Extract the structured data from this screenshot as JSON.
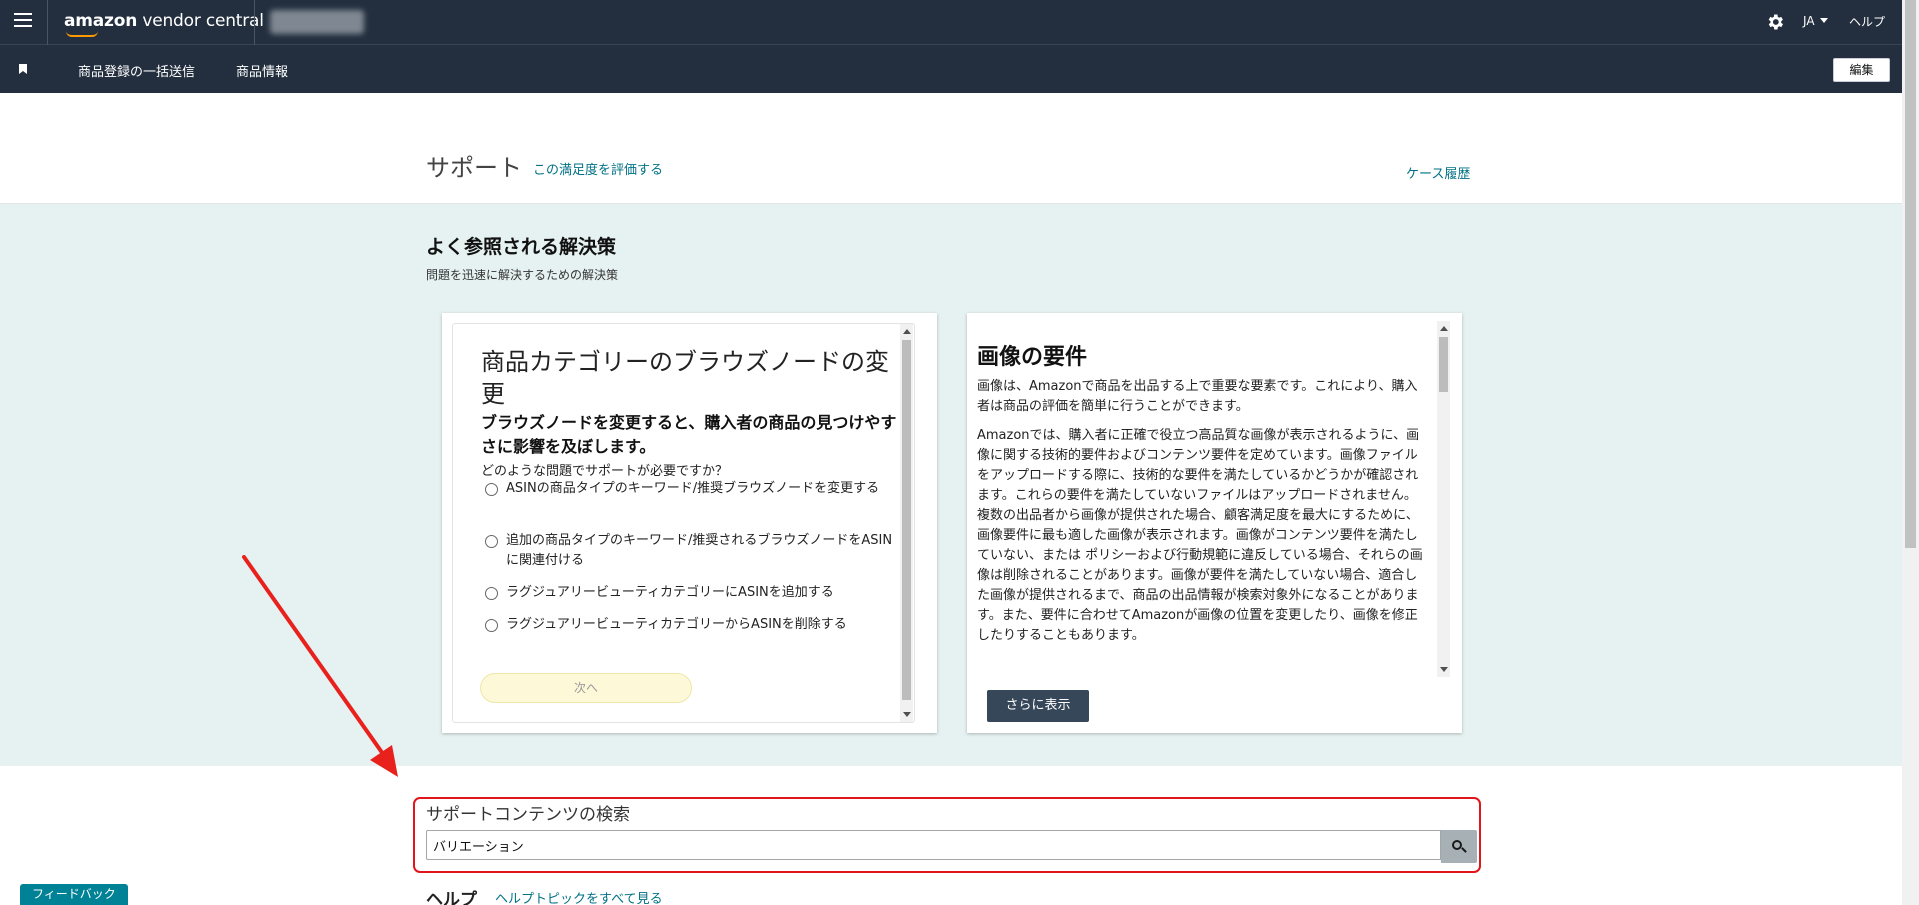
{
  "topbar": {
    "logo_brand": "amazon",
    "logo_product": " vendor central",
    "language": "JA",
    "help": "ヘルプ"
  },
  "subnav": {
    "items": [
      "商品登録の一括送信",
      "商品情報"
    ],
    "edit": "編集"
  },
  "header": {
    "title": "サポート",
    "rate": "この満足度を評価する",
    "cases": "ケース履歴"
  },
  "solutions": {
    "title": "よく参照される解決策",
    "subtitle": "問題を迅速に解決するための解決策",
    "card1": {
      "title": "商品カテゴリーのブラウズノードの変更",
      "bold": "ブラウズノードを変更すると、購入者の商品の見つけやすさに影響を及ぼします。",
      "question": "どのような問題でサポートが必要ですか？",
      "options": [
        "ASINの商品タイプのキーワード/推奨ブラウズノードを変更する",
        "追加の商品タイプのキーワード/推奨されるブラウズノードをASINに関連付ける",
        "ラグジュアリービューティカテゴリーにASINを追加する",
        "ラグジュアリービューティカテゴリーからASINを削除する"
      ],
      "next": "次へ"
    },
    "card2": {
      "title": "画像の要件",
      "p1": "画像は、Amazonで商品を出品する上で重要な要素です。これにより、購入者は商品の評価を簡単に行うことができます。",
      "p2": "Amazonでは、購入者に正確で役立つ高品質な画像が表示されるように、画像に関する技術的要件およびコンテンツ要件を定めています。画像ファイルをアップロードする際に、技術的な要件を満たしているかどうかが確認されます。これらの要件を満たしていないファイルはアップロードされません。複数の出品者から画像が提供された場合、顧客満足度を最大にするために、画像要件に最も適した画像が表示されます。画像がコンテンツ要件を満たしていない、または ポリシーおよび行動規範に違反している場合、それらの画像は削除されることがあります。画像が要件を満たしていない場合、適合した画像が提供されるまで、商品の出品情報が検索対象外になることがあります。また、要件に合わせてAmazonが画像の位置を変更したり、画像を修正したりすることもあります。",
      "more": "さらに表示"
    }
  },
  "search": {
    "label": "サポートコンテンツの検索",
    "value": "バリエーション"
  },
  "help": {
    "title": "ヘルプ",
    "link": "ヘルプトピックをすべて見る"
  },
  "feedback": "フィードバック ×",
  "colors": {
    "nav_bg": "#232f3e",
    "link": "#007185",
    "highlight": "#e0161a",
    "solutions_bg": "#e6f1f1"
  }
}
